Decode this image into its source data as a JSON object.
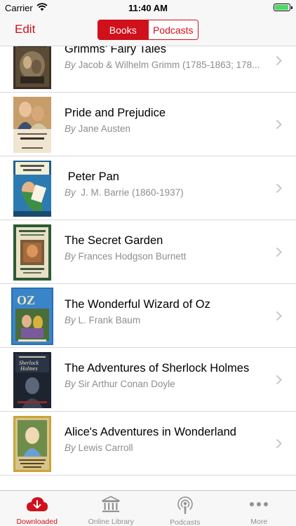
{
  "status_bar": {
    "carrier": "Carrier",
    "time": "11:40 AM",
    "battery_level": 1.0
  },
  "nav": {
    "edit_label": "Edit",
    "segments": [
      {
        "label": "Books",
        "selected": true
      },
      {
        "label": "Podcasts",
        "selected": false
      }
    ]
  },
  "books": [
    {
      "title": "Grimms' Fairy Tales",
      "by": "By",
      "author": "Jacob & Wilhelm Grimm (1785-1863; 178..."
    },
    {
      "title": "Pride and Prejudice",
      "by": "By",
      "author": "Jane Austen"
    },
    {
      "title": " Peter Pan",
      "by": "By",
      "author": " J. M. Barrie (1860-1937)"
    },
    {
      "title": "The Secret Garden",
      "by": "By",
      "author": "Frances Hodgson Burnett"
    },
    {
      "title": "The Wonderful Wizard of Oz",
      "by": "By",
      "author": "L. Frank Baum"
    },
    {
      "title": "The Adventures of Sherlock Holmes",
      "by": "By",
      "author": "Sir Arthur Conan Doyle"
    },
    {
      "title": "Alice's Adventures in Wonderland",
      "by": "By",
      "author": "Lewis Carroll"
    }
  ],
  "tabs": [
    {
      "label": "Downloaded",
      "icon": "cloud-download-icon",
      "active": true
    },
    {
      "label": "Online Library",
      "icon": "library-icon",
      "active": false
    },
    {
      "label": "Podcasts",
      "icon": "podcast-icon",
      "active": false
    },
    {
      "label": "More",
      "icon": "more-icon",
      "active": false
    }
  ],
  "colors": {
    "accent": "#d0101b",
    "inactive": "#929292",
    "secondary_text": "#8e8e93"
  }
}
